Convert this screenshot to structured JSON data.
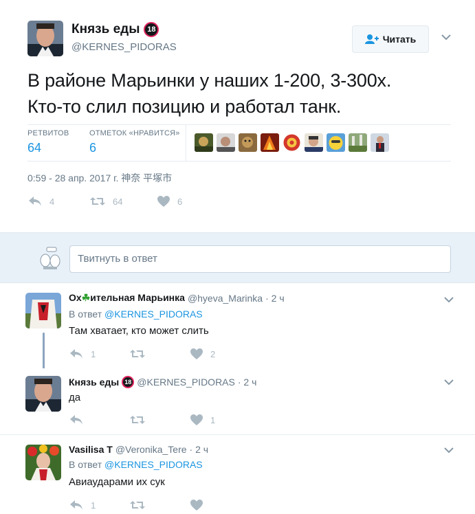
{
  "colors": {
    "accent": "#1b95e0",
    "muted": "#657786",
    "action_icon": "#aab8c2",
    "reply_box_bg": "#e8f0f8"
  },
  "main_tweet": {
    "author_name": "Князь еды",
    "badge_text": "18",
    "handle": "@KERNES_PIDORAS",
    "follow_label": "Читать",
    "text_line1": "В районе Марьинки у наших 1-200, 3-300х.",
    "text_line2": "Кто-то слил позицию и работал танк.",
    "retweets_label": "РЕТВИТОВ",
    "retweets_count": "64",
    "likes_label": "ОТМЕТОК «НРАВИТСЯ»",
    "likes_count": "6",
    "timestamp": "0:59 - 28 апр. 2017 г. 神奈 平塚市",
    "actions": {
      "reply_count": "4",
      "retweet_count": "64",
      "like_count": "6"
    }
  },
  "reply_box": {
    "placeholder": "Твитнуть в ответ"
  },
  "replies": [
    {
      "name_part1": "Ох",
      "name_part2": "ительная Марьинка",
      "handle": "@hyeva_Marinka",
      "time": "· 2 ч",
      "in_reply_prefix": "В ответ",
      "in_reply_handle": "@KERNES_PIDORAS",
      "text": "Там хватает, кто может слить",
      "reply_count": "1",
      "retweet_count": "",
      "like_count": "2"
    },
    {
      "name": "Князь еды",
      "badge_text": "18",
      "handle": "@KERNES_PIDORAS",
      "time": "· 2 ч",
      "text": "да",
      "reply_count": "",
      "retweet_count": "",
      "like_count": "1"
    },
    {
      "name": "Vasilisa T",
      "handle": "@Veronika_Tere",
      "time": "· 2 ч",
      "in_reply_prefix": "В ответ",
      "in_reply_handle": "@KERNES_PIDORAS",
      "text": "Авиаударами их сук",
      "reply_count": "1",
      "retweet_count": "",
      "like_count": ""
    }
  ]
}
